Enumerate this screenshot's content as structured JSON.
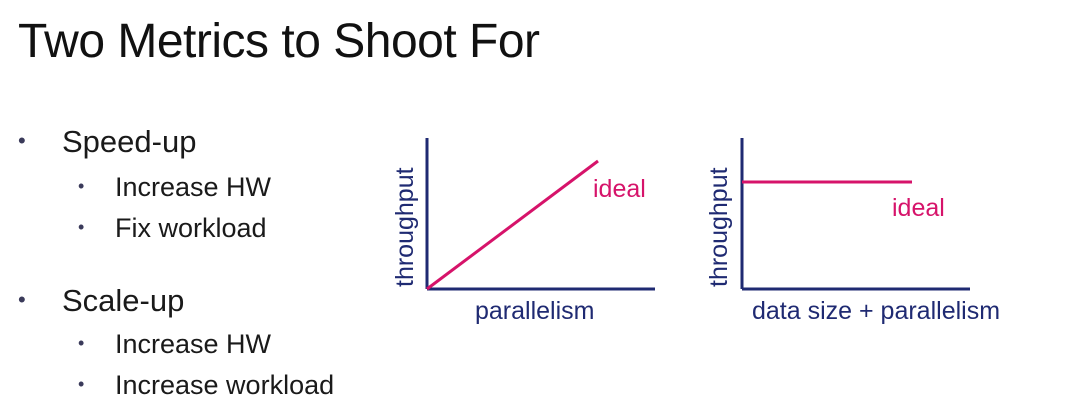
{
  "slide": {
    "title": "Two Metrics to Shoot For"
  },
  "bullets": [
    {
      "label": "Speed-up",
      "sub": [
        "Increase HW",
        "Fix workload"
      ]
    },
    {
      "label": "Scale-up",
      "sub": [
        "Increase HW",
        "Increase workload"
      ]
    }
  ],
  "bullet_glyph": "•",
  "diagrams": [
    {
      "ylabel": "throughput",
      "xlabel": "parallelism",
      "ideal_label": "ideal",
      "ideal_shape": "rising line"
    },
    {
      "ylabel": "throughput",
      "xlabel": "data size + parallelism",
      "ideal_label": "ideal",
      "ideal_shape": "flat line"
    }
  ],
  "colors": {
    "axis": "#1f2a72",
    "ideal": "#d6136a",
    "text": "#111111"
  }
}
